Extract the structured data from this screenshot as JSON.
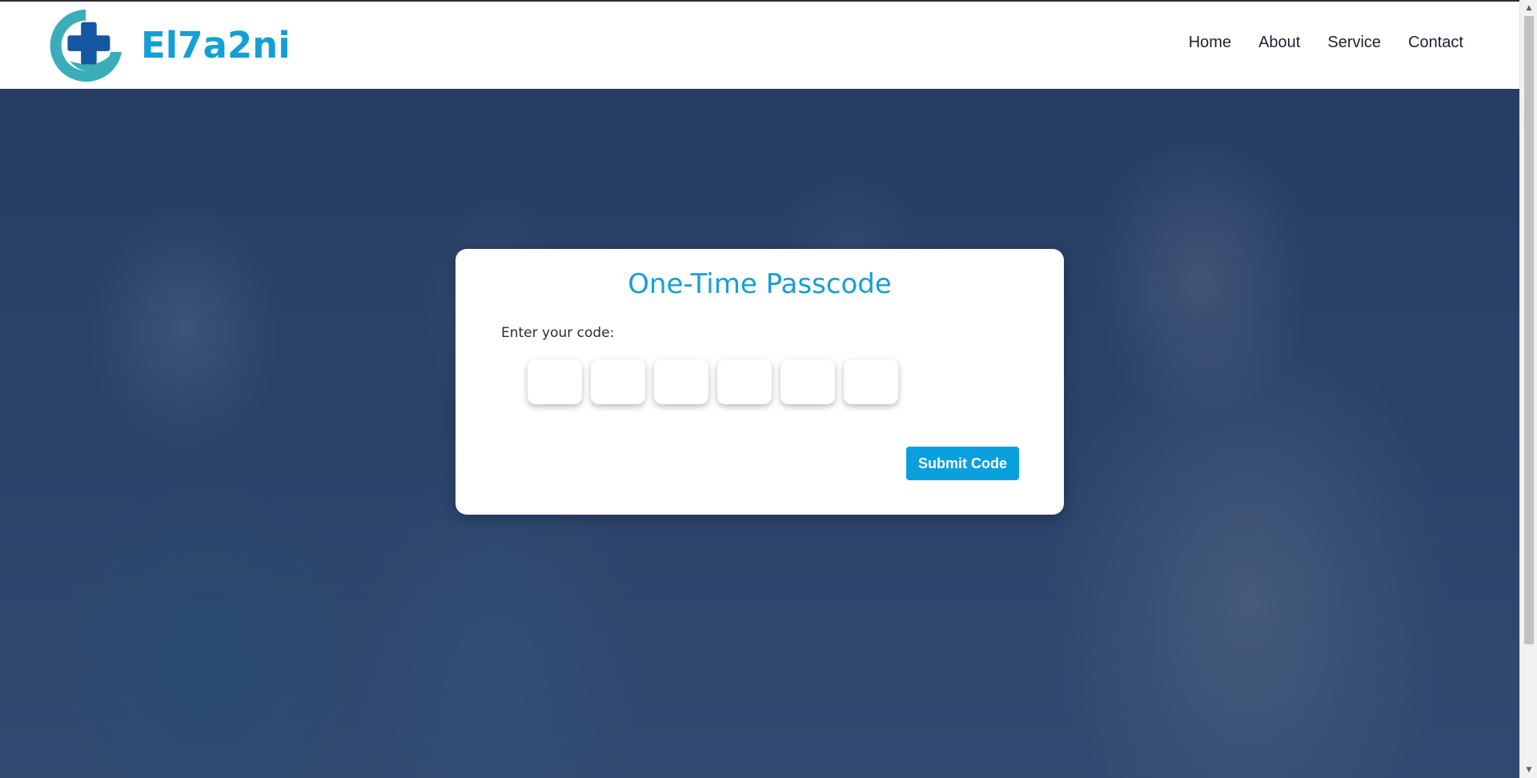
{
  "header": {
    "brand": "El7a2ni",
    "logo_icon": "medical-cross-hand-icon",
    "nav": [
      {
        "label": "Home"
      },
      {
        "label": "About"
      },
      {
        "label": "Service"
      },
      {
        "label": "Contact"
      }
    ]
  },
  "otp_card": {
    "title": "One-Time Passcode",
    "label": "Enter your code:",
    "digits": [
      "",
      "",
      "",
      "",
      "",
      ""
    ],
    "submit_label": "Submit Code"
  },
  "colors": {
    "brand": "#159fd6",
    "button": "#0aa0dd",
    "hero_overlay": "#1e345c"
  },
  "scrollbar": {
    "up_icon": "scroll-up-icon",
    "down_icon": "scroll-down-icon"
  }
}
